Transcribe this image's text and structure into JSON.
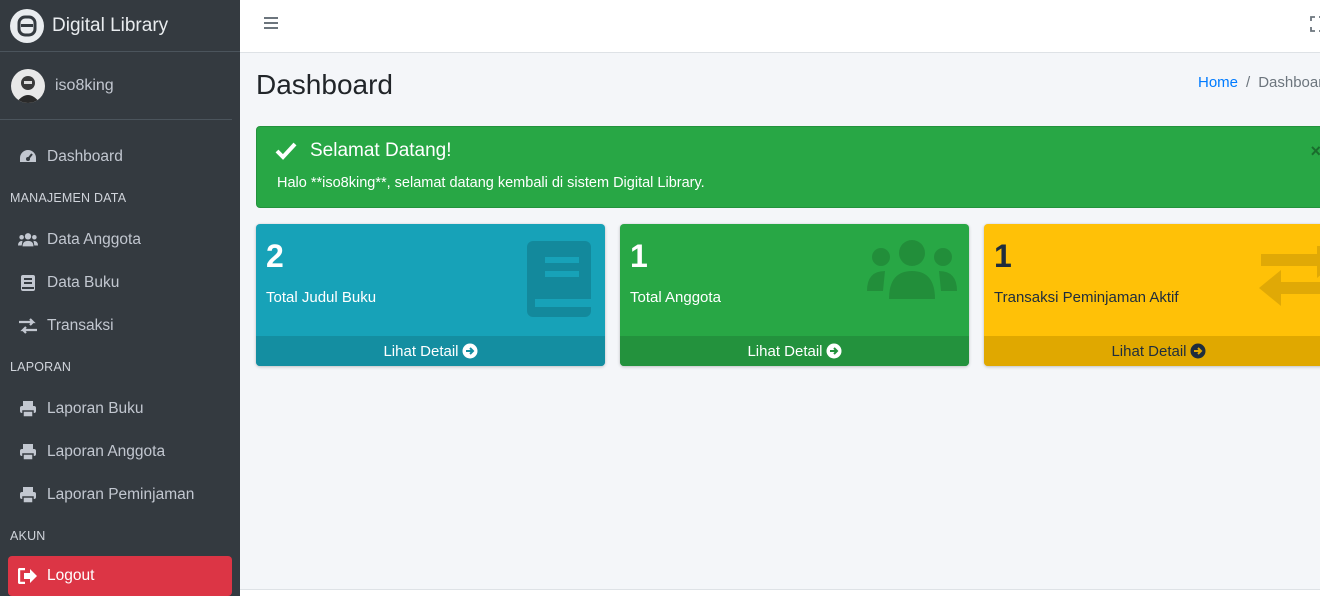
{
  "brand": {
    "title": "Digital Library"
  },
  "user": {
    "name": "iso8king"
  },
  "sidebar": {
    "items": [
      {
        "type": "item",
        "label": "Dashboard",
        "icon": "tachometer-icon"
      },
      {
        "type": "header",
        "label": "MANAJEMEN DATA"
      },
      {
        "type": "item",
        "label": "Data Anggota",
        "icon": "users-icon"
      },
      {
        "type": "item",
        "label": "Data Buku",
        "icon": "book-icon"
      },
      {
        "type": "item",
        "label": "Transaksi",
        "icon": "exchange-icon"
      },
      {
        "type": "header",
        "label": "LAPORAN"
      },
      {
        "type": "item",
        "label": "Laporan Buku",
        "icon": "print-icon"
      },
      {
        "type": "item",
        "label": "Laporan Anggota",
        "icon": "print-icon"
      },
      {
        "type": "item",
        "label": "Laporan Peminjaman",
        "icon": "print-icon"
      },
      {
        "type": "header",
        "label": "AKUN"
      },
      {
        "type": "item",
        "label": "Logout",
        "icon": "sign-out-icon"
      }
    ]
  },
  "page": {
    "title": "Dashboard"
  },
  "breadcrumb": {
    "home": "Home",
    "separator": "/",
    "current": "Dashboard"
  },
  "alert": {
    "title": "Selamat Datang!",
    "message": "Halo **iso8king**, selamat datang kembali di sistem Digital Library.",
    "close": "×"
  },
  "stats": {
    "books": {
      "value": "2",
      "label": "Total Judul Buku",
      "link": "Lihat Detail"
    },
    "members": {
      "value": "1",
      "label": "Total Anggota",
      "link": "Lihat Detail"
    },
    "loans": {
      "value": "1",
      "label": "Transaksi Peminjaman Aktif",
      "link": "Lihat Detail"
    }
  },
  "colors": {
    "sidebar": "#343a40",
    "info": "#17a2b8",
    "success": "#28a745",
    "warning": "#ffc107",
    "danger": "#dc3545",
    "link": "#007bff"
  }
}
